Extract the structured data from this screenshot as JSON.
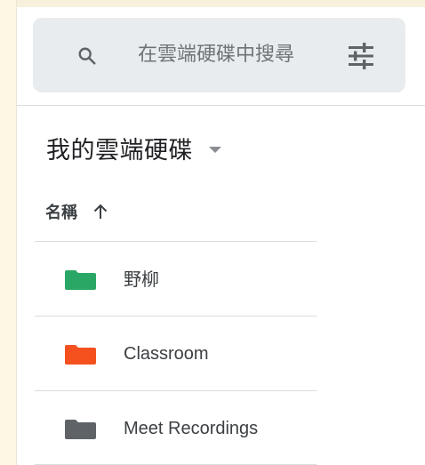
{
  "search": {
    "placeholder": "在雲端硬碟中搜尋"
  },
  "drive": {
    "title": "我的雲端硬碟"
  },
  "sort": {
    "label": "名稱",
    "direction": "ascending"
  },
  "files": [
    {
      "name": "野柳",
      "type": "folder",
      "color": "#2aa764"
    },
    {
      "name": "Classroom",
      "type": "folder",
      "color": "#f4511e"
    },
    {
      "name": "Meet Recordings",
      "type": "folder",
      "color": "#5f6368"
    }
  ],
  "icons": {
    "search": "search-icon",
    "tune": "tune-icon",
    "caret": "caret-down-icon",
    "sort_arrow": "arrow-up-icon",
    "folder": "folder-icon"
  }
}
